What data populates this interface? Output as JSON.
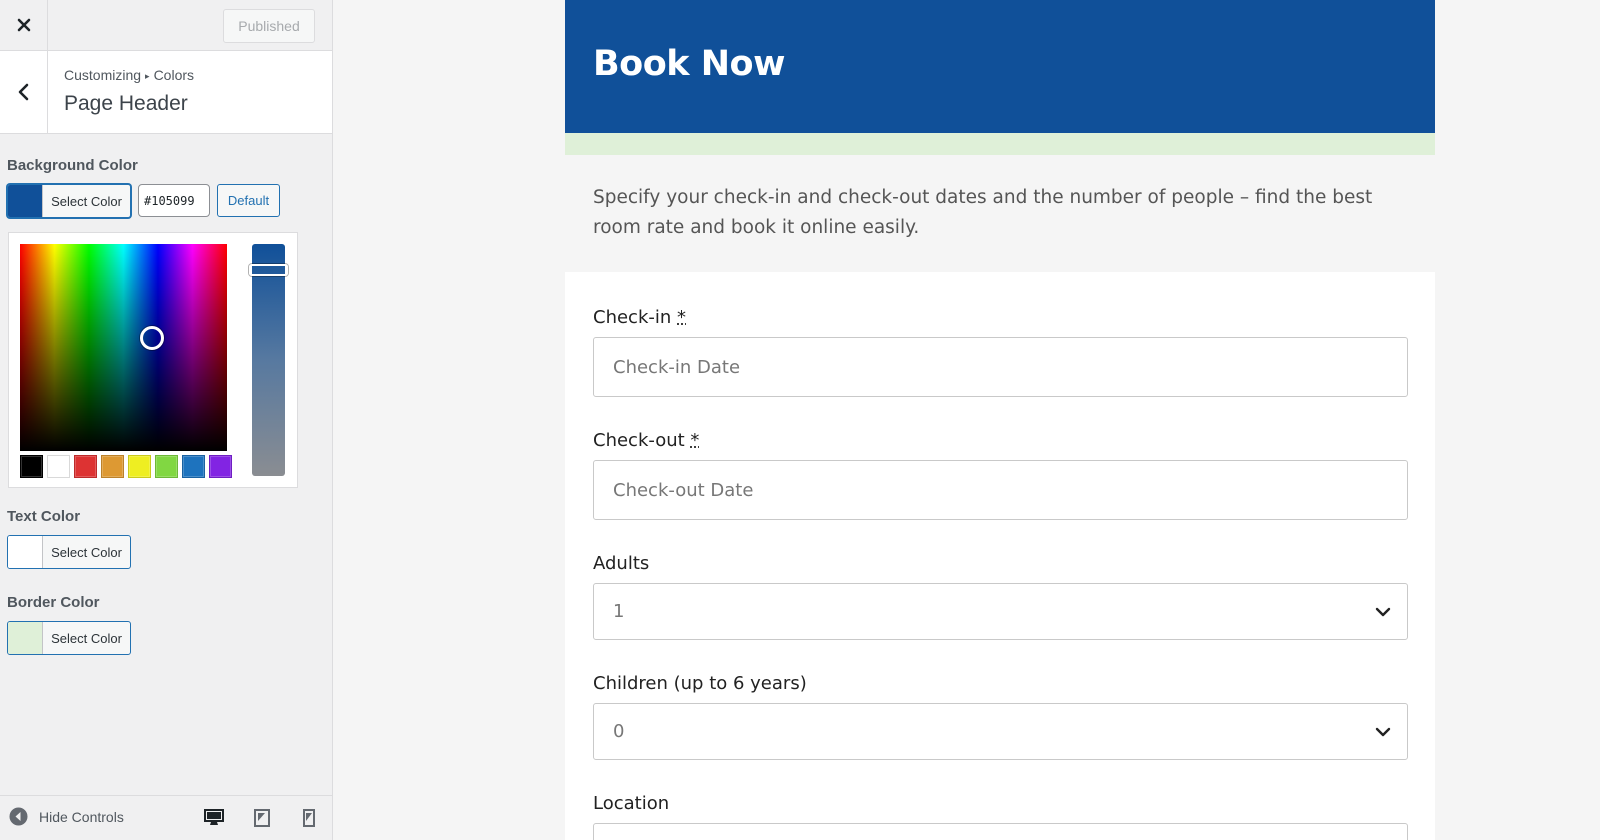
{
  "panel": {
    "published_label": "Published",
    "breadcrumb_parent": "Customizing",
    "breadcrumb_child": "Colors",
    "section_title": "Page Header",
    "background": {
      "label": "Background Color",
      "button_label": "Select Color",
      "hex_value": "#105099",
      "default_label": "Default",
      "swatch_color": "#105099"
    },
    "text_color": {
      "label": "Text Color",
      "button_label": "Select Color",
      "swatch_color": "#ffffff"
    },
    "border_color": {
      "label": "Border Color",
      "button_label": "Select Color",
      "swatch_color": "#dff0d8"
    },
    "palette": [
      "#000000",
      "#ffffff",
      "#dd3333",
      "#dd9933",
      "#eeee22",
      "#81d742",
      "#1e73be",
      "#8224e3"
    ],
    "footer": {
      "hide_controls_label": "Hide Controls"
    }
  },
  "preview": {
    "page_title": "Book Now",
    "intro_text": "Specify your check-in and check-out dates and the number of people – find the best room rate and book it online easily.",
    "fields": {
      "checkin_label": "Check-in",
      "checkin_required": "*",
      "checkin_placeholder": "Check-in Date",
      "checkout_label": "Check-out",
      "checkout_required": "*",
      "checkout_placeholder": "Check-out Date",
      "adults_label": "Adults",
      "adults_value": "1",
      "children_label": "Children (up to 6 years)",
      "children_value": "0",
      "location_label": "Location"
    }
  }
}
